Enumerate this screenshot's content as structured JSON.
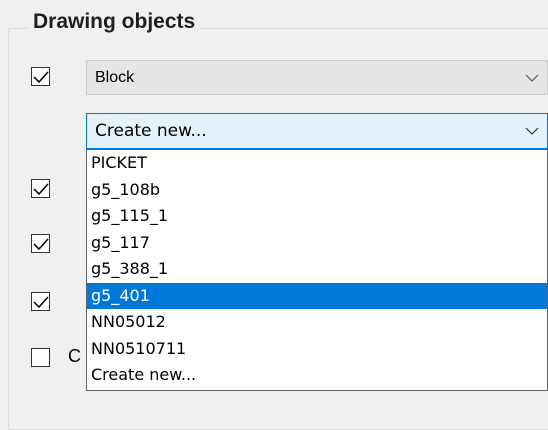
{
  "group": {
    "title": "Drawing objects"
  },
  "block_combo": {
    "value": "Block"
  },
  "create_combo": {
    "value": "Create new..."
  },
  "dropdown": {
    "items": [
      "PICKET",
      "g5_108b",
      "g5_115_1",
      "g5_117",
      "g5_388_1",
      "g5_401",
      "NN05012",
      "NN0510711",
      "Create new..."
    ],
    "selected_index": 5
  },
  "checkboxes": [
    true,
    true,
    true,
    true,
    false
  ],
  "partial_label": "C",
  "colors": {
    "selection": "#0078d7",
    "focus_border": "#0078d7",
    "focus_bg": "#e5f1fb",
    "disabled_bg": "#e5e5e5"
  },
  "icons": {
    "chevron": "chevron-down-icon",
    "check": "checkmark-icon"
  }
}
